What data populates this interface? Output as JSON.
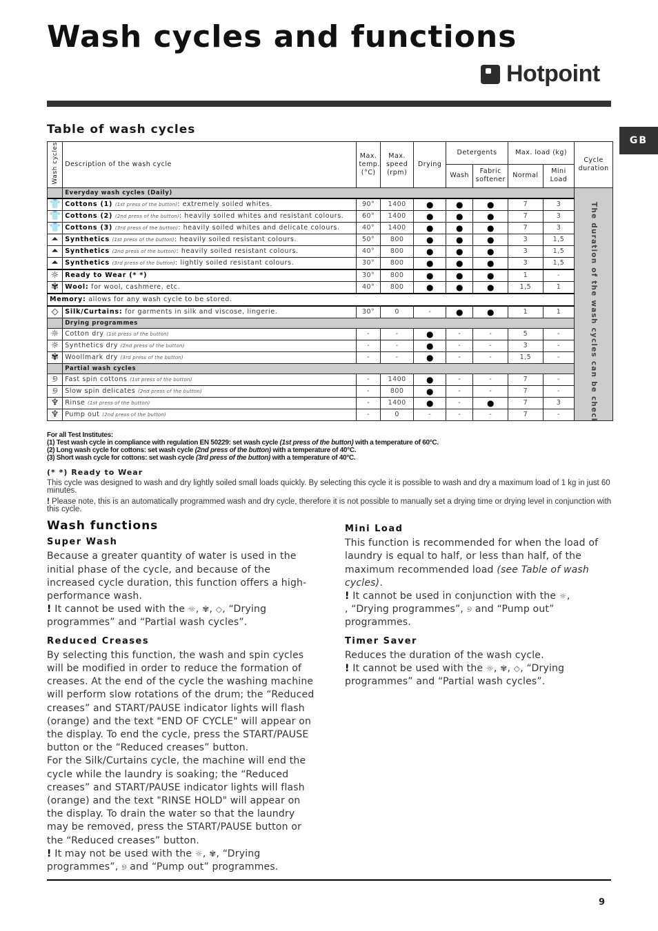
{
  "page": {
    "title": "Wash cycles and functions",
    "brand": "Hotpoint",
    "lang_tab": "GB",
    "page_number": "9"
  },
  "table": {
    "title": "Table of wash cycles",
    "headers": {
      "wash_cycles": "Wash cycles",
      "description": "Description of the wash cycle",
      "max_temp": "Max. temp. (°C)",
      "max_speed": "Max. speed (rpm)",
      "drying": "Drying",
      "detergents": "Detergents",
      "wash": "Wash",
      "fabric_softener": "Fabric softener",
      "max_load": "Max. load (kg)",
      "normal": "Normal",
      "mini_load": "Mini Load",
      "cycle_duration": "Cycle duration"
    },
    "duration_note": "The duration of the wash cycles can be checked on the display.",
    "sections": {
      "everyday": "Everyday wash cycles (Daily)",
      "drying": "Drying programmes",
      "partial": "Partial wash cycles"
    },
    "memory": {
      "label": "Memory:",
      "text": " allows for any wash cycle to be stored."
    },
    "rows": [
      {
        "icon": "cotton-icon",
        "name": "Cottons (1)",
        "press": "(1st press of the button)",
        "sep": ": ",
        "desc": "extremely soiled whites.",
        "temp": "90°",
        "speed": "1400",
        "drying": "●",
        "wash": "●",
        "softener": "●",
        "normal": "7",
        "mini": "3"
      },
      {
        "icon": "cotton-icon",
        "name": "Cottons (2)",
        "press": "(2nd press of the button)",
        "sep": ": ",
        "desc": "heavily soiled whites and resistant colours.",
        "temp": "60°",
        "speed": "1400",
        "drying": "●",
        "wash": "●",
        "softener": "●",
        "normal": "7",
        "mini": "3"
      },
      {
        "icon": "cotton-icon",
        "name": "Cottons (3)",
        "press": "(3rd press of the button)",
        "sep": ": ",
        "desc": "heavily soiled whites and delicate colours.",
        "temp": "40°",
        "speed": "1400",
        "drying": "●",
        "wash": "●",
        "softener": "●",
        "normal": "7",
        "mini": "3"
      },
      {
        "icon": "synthetics-icon",
        "name": "Synthetics",
        "press": "(1st press of the button)",
        "sep": ": ",
        "desc": "heavily soiled resistant colours.",
        "temp": "50°",
        "speed": "800",
        "drying": "●",
        "wash": "●",
        "softener": "●",
        "normal": "3",
        "mini": "1,5"
      },
      {
        "icon": "synthetics-icon",
        "name": "Synthetics",
        "press": "(2nd press of the button)",
        "sep": ": ",
        "desc": "heavily soiled resistant colours.",
        "temp": "40°",
        "speed": "800",
        "drying": "●",
        "wash": "●",
        "softener": "●",
        "normal": "3",
        "mini": "1,5"
      },
      {
        "icon": "synthetics-icon",
        "name": "Synthetics",
        "press": "(3rd press of the button)",
        "sep": ": ",
        "desc": "lightly soiled resistant colours.",
        "temp": "30°",
        "speed": "800",
        "drying": "●",
        "wash": "●",
        "softener": "●",
        "normal": "3",
        "mini": "1,5"
      },
      {
        "icon": "ready-to-wear-icon",
        "name": "Ready to Wear (* *)",
        "press": "",
        "sep": "",
        "desc": "",
        "temp": "30°",
        "speed": "800",
        "drying": "●",
        "wash": "●",
        "softener": "●",
        "normal": "1",
        "mini": "-"
      },
      {
        "icon": "wool-icon",
        "name": "Wool:",
        "press": "",
        "sep": " ",
        "desc": "for wool, cashmere, etc.",
        "temp": "40°",
        "speed": "800",
        "drying": "●",
        "wash": "●",
        "softener": "●",
        "normal": "1,5",
        "mini": "1"
      },
      {
        "icon": "silk-icon",
        "name": "Silk/Curtains:",
        "press": "",
        "sep": " ",
        "desc": "for garments in silk and viscose, lingerie.",
        "temp": "30°",
        "speed": "0",
        "drying": "-",
        "wash": "●",
        "softener": "●",
        "normal": "1",
        "mini": "1"
      },
      {
        "icon": "cotton-dry-icon",
        "name": "Cotton dry",
        "press": "(1st press of the button)",
        "sep": " ",
        "desc": "",
        "temp": "-",
        "speed": "-",
        "drying": "●",
        "wash": "-",
        "softener": "-",
        "normal": "5",
        "mini": "-"
      },
      {
        "icon": "synthetics-dry-icon",
        "name": "Synthetics dry",
        "press": "(2nd press of the button)",
        "sep": " ",
        "desc": "",
        "temp": "-",
        "speed": "-",
        "drying": "●",
        "wash": "-",
        "softener": "-",
        "normal": "3",
        "mini": "-"
      },
      {
        "icon": "woolmark-dry-icon",
        "name": "Woollmark dry",
        "press": "(3rd press of the button)",
        "sep": " ",
        "desc": "",
        "temp": "-",
        "speed": "-",
        "drying": "●",
        "wash": "-",
        "softener": "-",
        "normal": "1,5",
        "mini": "-"
      },
      {
        "icon": "spin-icon",
        "name": "Fast spin cottons",
        "press": "(1st press of the button)",
        "sep": " ",
        "desc": "",
        "temp": "-",
        "speed": "1400",
        "drying": "●",
        "wash": "-",
        "softener": "-",
        "normal": "7",
        "mini": "-"
      },
      {
        "icon": "spin-icon",
        "name": "Slow spin delicates",
        "press": "(2nd press of the button)",
        "sep": " ",
        "desc": "",
        "temp": "-",
        "speed": "800",
        "drying": "●",
        "wash": "-",
        "softener": "-",
        "normal": "7",
        "mini": "-"
      },
      {
        "icon": "rinse-icon",
        "name": "Rinse",
        "press": "(1st press of the button)",
        "sep": " ",
        "desc": "",
        "temp": "-",
        "speed": "1400",
        "drying": "●",
        "wash": "-",
        "softener": "●",
        "normal": "7",
        "mini": "3"
      },
      {
        "icon": "rinse-icon",
        "name": "Pump out",
        "press": "(2nd press of the button)",
        "sep": " ",
        "desc": "",
        "temp": "-",
        "speed": "0",
        "drying": "-",
        "wash": "-",
        "softener": "-",
        "normal": "7",
        "mini": "-"
      }
    ]
  },
  "notes": {
    "heading": "For all Test Institutes:",
    "lines": [
      {
        "pre": "(1) Test wash cycle in compliance with regulation EN 50229: set wash cycle ",
        "em": "(1st press of the button)",
        "post": " with a temperature of 60°C."
      },
      {
        "pre": "(2) Long wash cycle for cottons: set wash cycle ",
        "em": "(2nd press of the button)",
        "post": " with a temperature of 40°C."
      },
      {
        "pre": "(3) Short wash cycle for cottons: set wash cycle ",
        "em": "(3rd press of the button)",
        "post": " with a temperature of 40°C."
      }
    ]
  },
  "ready_to_wear": {
    "title": "(* *) Ready to Wear",
    "body": "This cycle was designed to wash and dry lightly soiled small loads quickly. By selecting this cycle it is possible to wash and dry a maximum load of 1 kg in just 60 minutes.",
    "note": "Please note, this is an automatically programmed wash and dry cycle, therefore it is not possible to manually set a drying time or drying level in conjunction with this cycle."
  },
  "wash_functions": {
    "title": "Wash functions",
    "super_wash": {
      "title": "Super  Wash",
      "body": "Because a greater quantity of water is used in the initial phase of the cycle, and because of the increased cycle duration, this function offers a high-performance wash.",
      "warn_pre": "It cannot be used with the ",
      "warn_post": ", “Drying programmes” and “Partial wash cycles”."
    },
    "reduced_creases": {
      "title": "Reduced  Creases",
      "body1": "By selecting this function, the wash and spin cycles will be modified in order to reduce the formation of creases. At the end of the cycle the washing machine will perform slow rotations of the drum; the “Reduced creases” and START/PAUSE indicator lights will flash (orange) and the text \"END OF CYCLE\" will appear on the display. To end the cycle, press the START/PAUSE button or the “Reduced creases” button.",
      "body2": "For the Silk/Curtains cycle, the machine will end the cycle while the laundry is soaking; the “Reduced creases” and START/PAUSE indicator lights will flash (orange) and the text \"RINSE HOLD\" will appear on the display. To drain the water so that the laundry may be removed, press the START/PAUSE button or the “Reduced creases” button.",
      "warn_pre": "It may not be used with the ",
      "warn_mid": ", “Drying programmes”, ",
      "warn_post": " and “Pump out” programmes."
    },
    "mini_load": {
      "title": "Mini  Load",
      "body": "This function is recommended for when the load of laundry is equal to half, or less than half, of the maximum recommended load ",
      "body_em": "(see Table of wash cycles)",
      "warn_pre": "It cannot be used in conjunction with the ",
      "warn_mid": ", “Drying programmes”, ",
      "warn_post": " and “Pump out” programmes."
    },
    "timer_saver": {
      "title": "Timer  Saver",
      "body": "Reduces the duration of the wash cycle.",
      "warn_pre": "It cannot be used with the ",
      "warn_post": ", “Drying programmes” and “Partial wash cycles”."
    }
  },
  "icons": {
    "cotton-icon": "👕",
    "synthetics-icon": "⏶",
    "ready-to-wear-icon": "☼",
    "wool-icon": "✾",
    "silk-icon": "◇",
    "cotton-dry-icon": "☼",
    "synthetics-dry-icon": "☼",
    "woolmark-dry-icon": "✾",
    "spin-icon": "୭",
    "rinse-icon": "♆"
  },
  "bang": "!"
}
